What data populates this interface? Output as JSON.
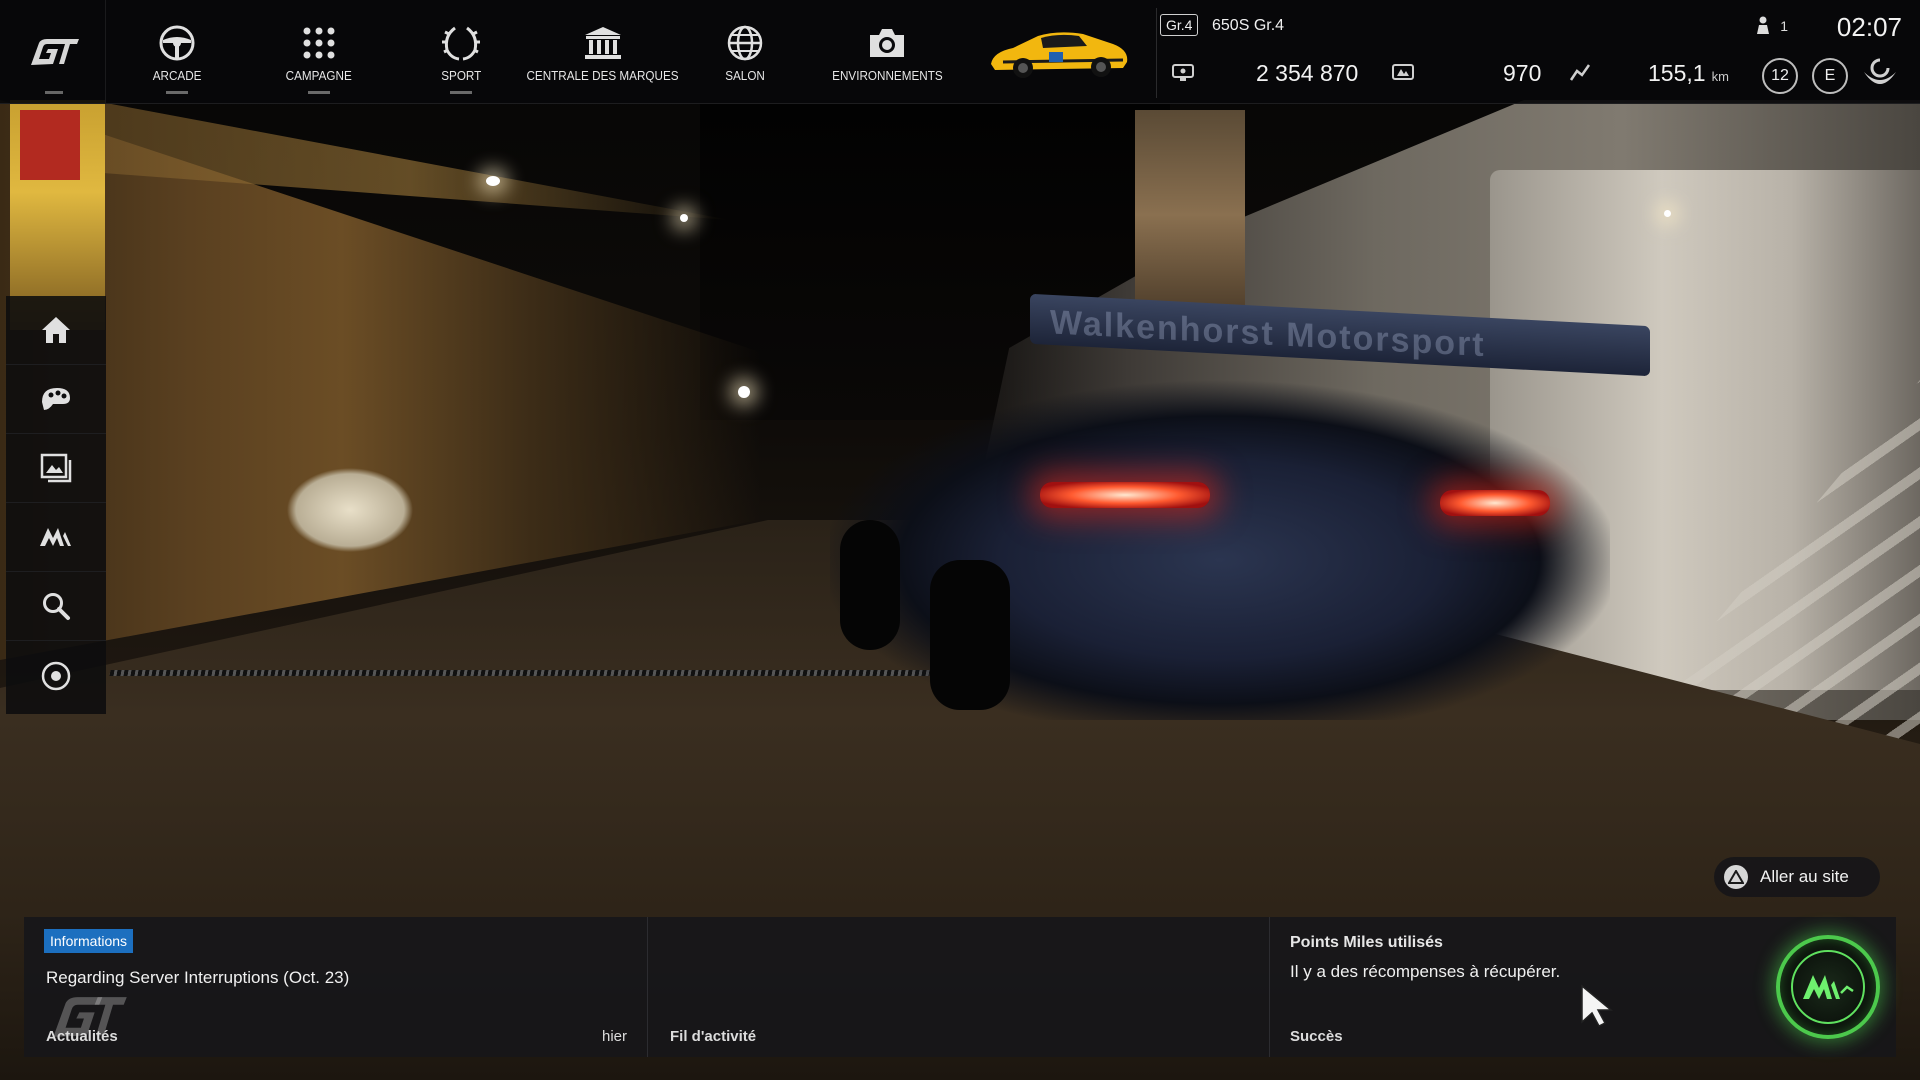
{
  "topbar": {
    "nav": [
      {
        "label": "ARCADE",
        "icon": "steering-wheel-icon"
      },
      {
        "label": "CAMPAGNE",
        "icon": "dot-grid-icon"
      },
      {
        "label": "SPORT",
        "icon": "laurel-icon"
      },
      {
        "label": "CENTRALE DES MARQUES",
        "icon": "museum-icon"
      },
      {
        "label": "SALON",
        "icon": "globe-icon"
      },
      {
        "label": "ENVIRONNEMENTS",
        "icon": "camera-icon"
      }
    ],
    "car": {
      "class_badge": "Gr.4",
      "name": "650S Gr.4"
    },
    "friends_online": "1",
    "clock": "02:07",
    "credits": "2 354 870",
    "mileage_points": "970",
    "distance": "155,1",
    "distance_unit": "km",
    "level": "12",
    "rating": "E"
  },
  "sidebar": {
    "items": [
      {
        "name": "home",
        "icon": "home-icon"
      },
      {
        "name": "livery",
        "icon": "palette-helmet-icon"
      },
      {
        "name": "gallery",
        "icon": "gallery-icon"
      },
      {
        "name": "mileage",
        "icon": "mileage-icon"
      },
      {
        "name": "search",
        "icon": "search-icon"
      },
      {
        "name": "options",
        "icon": "options-icon"
      }
    ]
  },
  "scene": {
    "wing_text": "Walkenhorst Motorsport"
  },
  "go_site": {
    "label": "Aller au site"
  },
  "bottom": {
    "news": {
      "tag": "Informations",
      "title": "Regarding Server Interruptions (Oct. 23)",
      "footer": "Actualités",
      "time": "hier"
    },
    "feed": {
      "footer": "Fil d'activité"
    },
    "miles": {
      "title": "Points Miles utilisés",
      "subtitle": "Il y a des récompenses à récupérer.",
      "footer": "Succès"
    }
  },
  "colors": {
    "accent_blue": "#1c6fbf",
    "miles_green": "#4cc94c",
    "bar_bg": "#08080a"
  }
}
